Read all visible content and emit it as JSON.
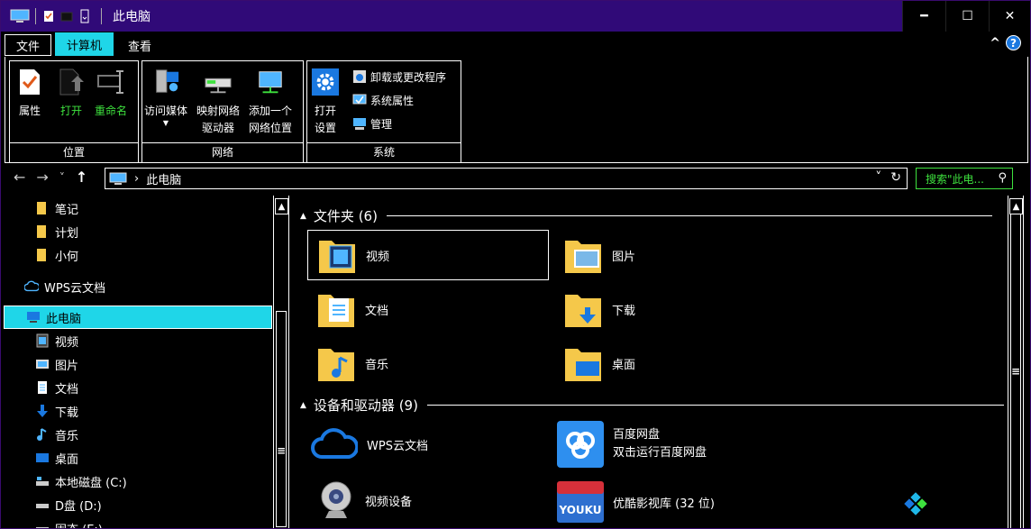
{
  "window": {
    "title": "此电脑",
    "minimize": "━",
    "maximize": "☐",
    "close": "✕"
  },
  "ribbon_tabs": [
    {
      "label": "文件"
    },
    {
      "label": "计算机"
    },
    {
      "label": "查看"
    }
  ],
  "ribbon": {
    "groups": {
      "location": "位置",
      "network": "网络",
      "system": "系统"
    },
    "buttons": {
      "properties": "属性",
      "open": "打开",
      "rename": "重命名",
      "access_media_1": "访问媒体",
      "map_drive_1": "映射网络",
      "map_drive_2": "驱动器",
      "add_location_1": "添加一个",
      "add_location_2": "网络位置",
      "open_settings_1": "打开",
      "open_settings_2": "设置",
      "uninstall": "卸载或更改程序",
      "system_properties": "系统属性",
      "manage": "管理"
    },
    "help": "?",
    "collapse": "^"
  },
  "address": {
    "back": "←",
    "forward": "→",
    "recent": "˅",
    "up": "↑",
    "crumb_sep": "›",
    "crumb": "此电脑",
    "dropdown": "˅",
    "refresh": "↻",
    "search_placeholder": "搜索\"此电...",
    "search_icon": "⚲"
  },
  "nav": {
    "items": [
      {
        "label": "笔记"
      },
      {
        "label": "计划"
      },
      {
        "label": "小何"
      },
      {
        "label": "WPS云文档"
      },
      {
        "label": "此电脑"
      },
      {
        "label": "视频"
      },
      {
        "label": "图片"
      },
      {
        "label": "文档"
      },
      {
        "label": "下载"
      },
      {
        "label": "音乐"
      },
      {
        "label": "桌面"
      },
      {
        "label": "本地磁盘 (C:)"
      },
      {
        "label": "D盘 (D:)"
      },
      {
        "label": "固态 (E:)"
      }
    ]
  },
  "content": {
    "folders_header": "文件夹 (6)",
    "folders": [
      {
        "label": "视频"
      },
      {
        "label": "图片"
      },
      {
        "label": "文档"
      },
      {
        "label": "下载"
      },
      {
        "label": "音乐"
      },
      {
        "label": "桌面"
      }
    ],
    "devices_header": "设备和驱动器 (9)",
    "devices": [
      {
        "label": "WPS云文档"
      },
      {
        "label": "百度网盘",
        "sub": "双击运行百度网盘"
      },
      {
        "label": "视频设备"
      },
      {
        "label": "优酷影视库 (32 位)"
      }
    ]
  },
  "colors": {
    "titlebar": "#300a78",
    "accent": "#1fd6e8",
    "green_text": "#3ee13e"
  }
}
